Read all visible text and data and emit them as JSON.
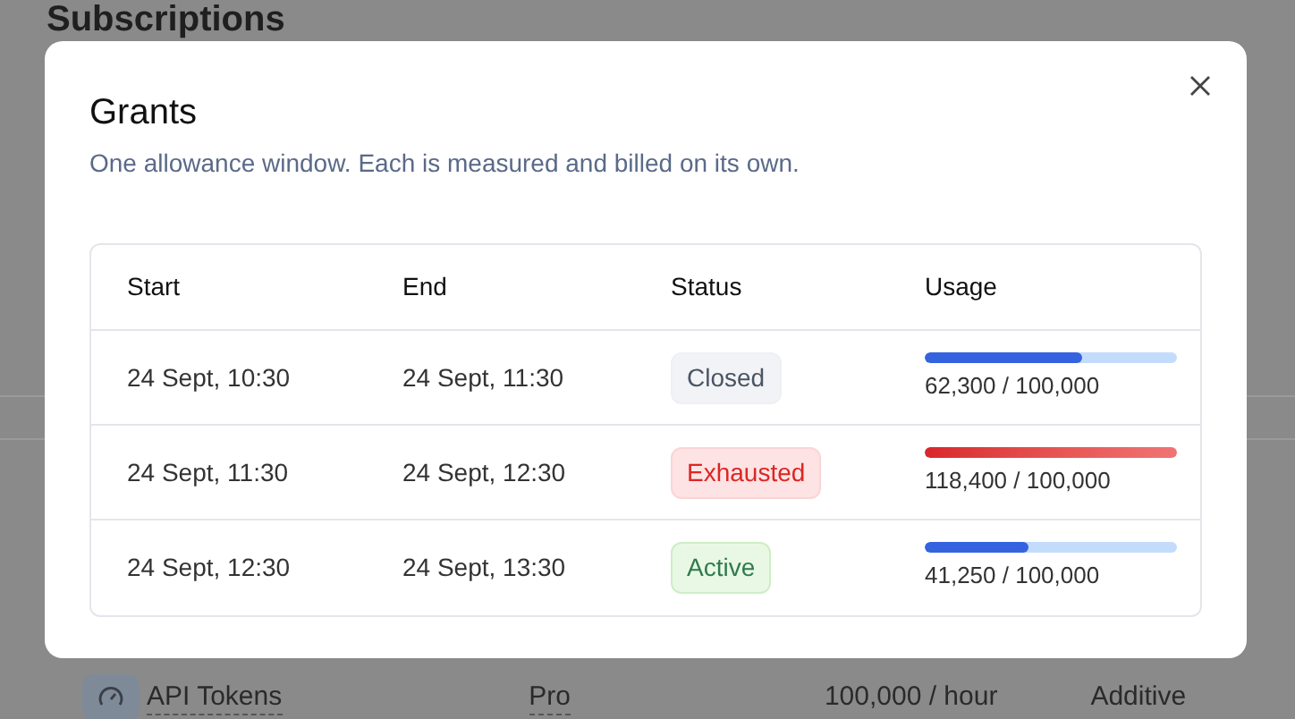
{
  "page": {
    "title": "Subscriptions",
    "row": {
      "name": "API Tokens",
      "plan": "Pro",
      "limit": "100,000 / hour",
      "mode": "Additive"
    }
  },
  "dialog": {
    "title": "Grants",
    "description": "One allowance window. Each is measured and billed on its own.",
    "table": {
      "columns": [
        "Start",
        "End",
        "Status",
        "Usage"
      ],
      "rows": [
        {
          "start": "24 Sept, 10:30",
          "end": "24 Sept, 11:30",
          "status": {
            "kind": "closed",
            "label": "Closed"
          },
          "usage": {
            "level": 0.623,
            "reading": "62,300 / 100,000"
          }
        },
        {
          "start": "24 Sept, 11:30",
          "end": "24 Sept, 12:30",
          "status": {
            "kind": "exhausted",
            "label": "Exhausted"
          },
          "usage": {
            "level": 1,
            "reading": "118,400 / 100,000"
          }
        },
        {
          "start": "24 Sept, 12:30",
          "end": "24 Sept, 13:30",
          "status": {
            "kind": "active",
            "label": "Active"
          },
          "usage": {
            "level": 0.4125,
            "reading": "41,250 / 100,000"
          }
        }
      ]
    }
  }
}
